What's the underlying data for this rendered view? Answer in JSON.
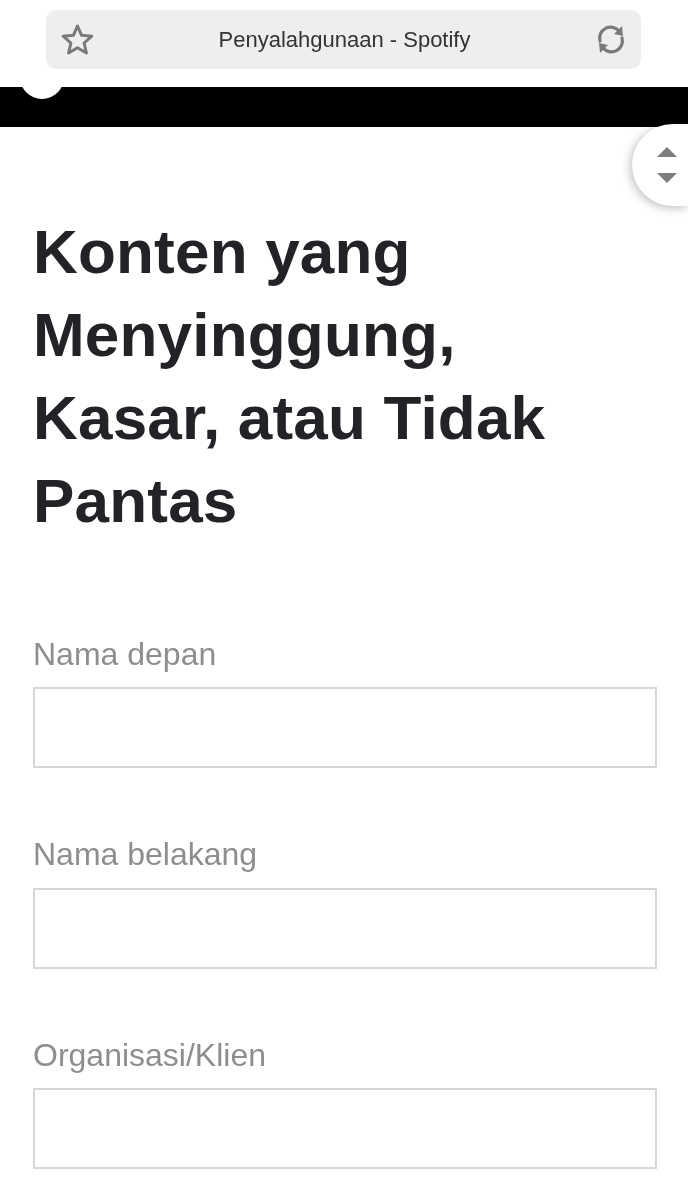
{
  "browser_bar": {
    "title": "Penyalahgunaan - Spotify"
  },
  "heading": "Konten yang Menyinggung, Kasar, atau Tidak Pantas",
  "fields": [
    {
      "label": "Nama depan"
    },
    {
      "label": "Nama belakang"
    },
    {
      "label": "Organisasi/Klien"
    }
  ]
}
